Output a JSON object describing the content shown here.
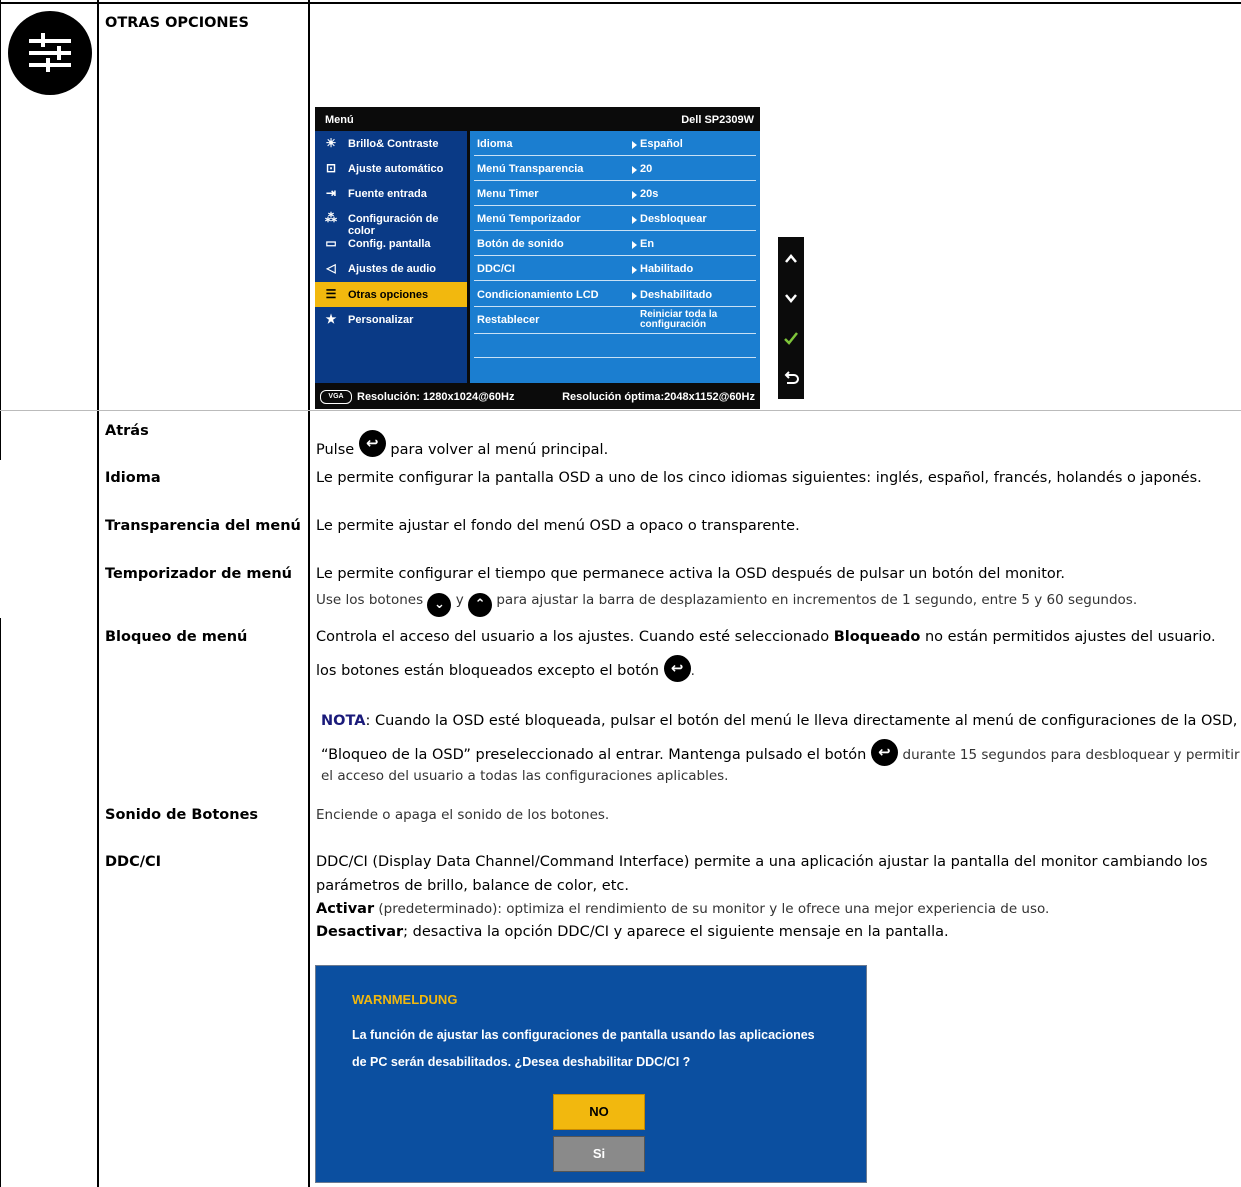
{
  "section": {
    "title": "OTRAS OPCIONES",
    "icon": "sliders-icon"
  },
  "osd": {
    "header_left": "Menú",
    "header_right": "Dell SP2309W",
    "left_menu": [
      {
        "label": "Brillo& Contraste",
        "icon": "brightness-icon",
        "selected": false
      },
      {
        "label": "Ajuste automático",
        "icon": "auto-adjust-icon",
        "selected": false
      },
      {
        "label": "Fuente entrada",
        "icon": "input-source-icon",
        "selected": false
      },
      {
        "label": "Configuración de color",
        "icon": "color-dots-icon",
        "selected": false
      },
      {
        "label": "Config. pantalla",
        "icon": "display-icon",
        "selected": false
      },
      {
        "label": "Ajustes de audio",
        "icon": "speaker-icon",
        "selected": false
      },
      {
        "label": "Otras opciones",
        "icon": "sliders-icon",
        "selected": true
      },
      {
        "label": "Personalizar",
        "icon": "star-icon",
        "selected": false
      }
    ],
    "settings": [
      {
        "name": "Idioma",
        "value": "Español"
      },
      {
        "name": "Menú Transparencia",
        "value": "20"
      },
      {
        "name": "Menu Timer",
        "value": "20s"
      },
      {
        "name": "Menú Temporizador",
        "value": "Desbloquear"
      },
      {
        "name": "Botón de sonido",
        "value": "En"
      },
      {
        "name": "DDC/CI",
        "value": "Habilitado"
      },
      {
        "name": "Condicionamiento LCD",
        "value": "Deshabilitado"
      },
      {
        "name": "Restablecer",
        "value_line1": "Reiniciar toda la",
        "value_line2": "configuración"
      }
    ],
    "footer_badge": "VGA",
    "footer_left": "Resolución: 1280x1024@60Hz",
    "footer_right": "Resolución óptima:2048x1152@60Hz",
    "side_buttons": [
      "up-arrow-icon",
      "down-arrow-icon",
      "check-icon",
      "back-icon"
    ]
  },
  "rows": {
    "atras": {
      "label": "Atrás",
      "pre": "Pulse",
      "post": "para volver al menú principal."
    },
    "idioma": {
      "label": "Idioma",
      "text": "Le permite configurar la pantalla OSD a uno de los cinco idiomas siguientes: inglés, español, francés, holandés o japonés."
    },
    "transparencia": {
      "label": "Transparencia del menú",
      "text": "Le permite ajustar el fondo del menú OSD a opaco o transparente."
    },
    "temporizador": {
      "label": "Temporizador de menú",
      "text1": "Le permite configurar el tiempo que permanece activa la OSD después de pulsar un botón del monitor.",
      "text2_a": "Use los botones",
      "text2_b": "y",
      "text2_c": "para ajustar la barra de desplazamiento en incrementos de 1 segundo, entre 5 y 60 segundos."
    },
    "bloqueo": {
      "label": "Bloqueo de menú",
      "line1_a": "Controla el acceso del usuario a los ajustes. Cuando esté seleccionado",
      "line1_bold": "Bloqueado",
      "line1_b": "no están permitidos ajustes del usuario.",
      "line2": "los botones están bloqueados excepto el botón",
      "line2_end": ".",
      "nota_label": "NOTA",
      "nota_text": ": Cuando la OSD esté bloqueada, pulsar el botón del menú le lleva directamente al menú de configuraciones de la OSD,",
      "nota2_a": "“Bloqueo de la OSD”",
      "nota2_b": "preseleccionado al entrar. Mantenga pulsado el botón",
      "nota2_c": "durante 15 segundos para desbloquear y permitir",
      "nota3": "el acceso del usuario a todas las configuraciones aplicables."
    },
    "sonido": {
      "label": "Sonido de Botones",
      "text": "Enciende o apaga el sonido de los botones."
    },
    "ddc": {
      "label": "DDC/CI",
      "text1": "DDC/CI (Display Data Channel/Command Interface) permite a una aplicación ajustar la pantalla del monitor cambiando los",
      "text2": "parámetros de brillo, balance de color, etc.",
      "activar_bold": "Activar",
      "activar_text": "(predeterminado): optimiza el rendimiento de su monitor y le ofrece una mejor experiencia de uso.",
      "desactivar_bold": "Desactivar",
      "desactivar_text": "; desactiva la opción DDC/CI y aparece el siguiente mensaje en la pantalla."
    }
  },
  "warning": {
    "title": "WARNMELDUNG",
    "line1": "La función de ajustar las configuraciones de pantalla usando las aplicaciones",
    "line2": "de PC serán desabilitados. ¿Desea deshabilitar DDC/CI ?",
    "btn_no": "NO",
    "btn_si": "Si"
  },
  "colors": {
    "osd_left": "#0a3a86",
    "osd_right": "#1b7ed0",
    "highlight": "#f2b80e",
    "nota": "#1a1a7a"
  }
}
